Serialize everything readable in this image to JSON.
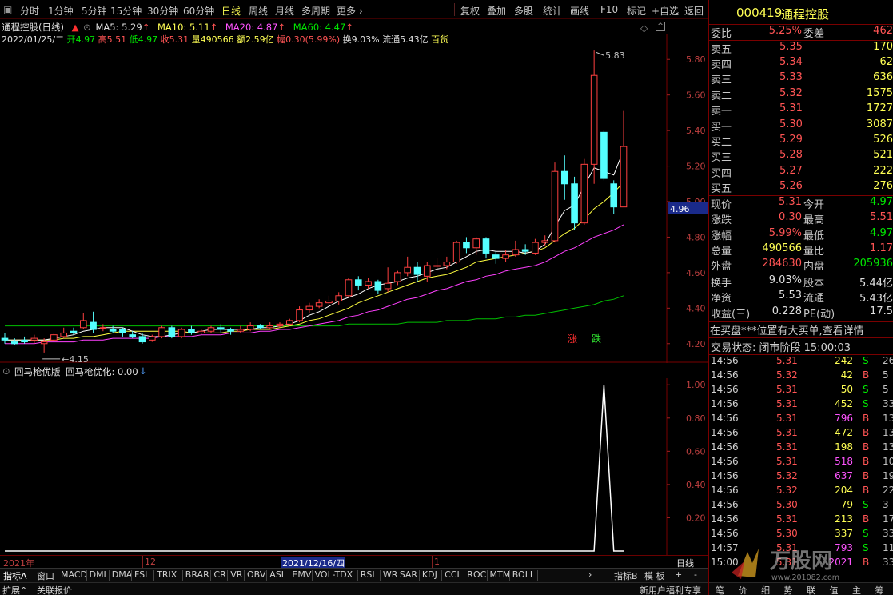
{
  "toolbar": {
    "left_items": [
      "分时",
      "1分钟",
      "5分钟",
      "15分钟",
      "30分钟",
      "60分钟",
      "日线",
      "周线",
      "月线",
      "多周期",
      "更多"
    ],
    "active_index": 6,
    "right_items": [
      "复权",
      "叠加",
      "多股",
      "统计",
      "画线",
      "F10",
      "标记",
      "+自选",
      "返回"
    ]
  },
  "info": {
    "title": "通程控股(日线)",
    "ma5": "MA5: 5.29",
    "ma10": "MA10: 5.11",
    "ma20": "MA20: 4.87",
    "ma60": "MA60: 4.47",
    "date": "2022/01/25/二",
    "open": "开4.97",
    "high": "高5.51",
    "low": "低4.97",
    "close": "收5.31",
    "vol": "量490566",
    "amount": "额2.59亿",
    "change": "幅0.30(5.99%)",
    "turnover": "换9.03%",
    "float": "流通5.43亿",
    "sector": "百货"
  },
  "chart_data": {
    "type": "candlestick",
    "price_ticks": [
      "5.80",
      "5.60",
      "5.40",
      "5.20",
      "5.00",
      "4.80",
      "4.60",
      "4.40",
      "4.20"
    ],
    "current_price_label": "4.96",
    "max_label": "5.83",
    "min_label": "4.15",
    "candles": [
      [
        4.23,
        4.22,
        4.26,
        4.2
      ],
      [
        4.21,
        4.2,
        4.23,
        4.19
      ],
      [
        4.22,
        4.21,
        4.24,
        4.2
      ],
      [
        4.22,
        4.23,
        4.25,
        4.2
      ],
      [
        4.2,
        4.21,
        4.23,
        4.15
      ],
      [
        4.22,
        4.25,
        4.26,
        4.21
      ],
      [
        4.24,
        4.26,
        4.29,
        4.23
      ],
      [
        4.27,
        4.26,
        4.29,
        4.25
      ],
      [
        4.29,
        4.33,
        4.37,
        4.28
      ],
      [
        4.32,
        4.28,
        4.38,
        4.26
      ],
      [
        4.29,
        4.29,
        4.31,
        4.27
      ],
      [
        4.28,
        4.27,
        4.3,
        4.26
      ],
      [
        4.28,
        4.26,
        4.29,
        4.24
      ],
      [
        4.25,
        4.24,
        4.27,
        4.23
      ],
      [
        4.24,
        4.21,
        4.26,
        4.2
      ],
      [
        4.22,
        4.24,
        4.25,
        4.21
      ],
      [
        4.24,
        4.29,
        4.3,
        4.23
      ],
      [
        4.29,
        4.24,
        4.3,
        4.23
      ],
      [
        4.24,
        4.28,
        4.29,
        4.23
      ],
      [
        4.28,
        4.26,
        4.3,
        4.25
      ],
      [
        4.26,
        4.27,
        4.28,
        4.25
      ],
      [
        4.27,
        4.29,
        4.3,
        4.26
      ],
      [
        4.29,
        4.28,
        4.31,
        4.26
      ],
      [
        4.28,
        4.27,
        4.29,
        4.25
      ],
      [
        4.27,
        4.28,
        4.3,
        4.26
      ],
      [
        4.28,
        4.3,
        4.32,
        4.27
      ],
      [
        4.3,
        4.29,
        4.31,
        4.28
      ],
      [
        4.29,
        4.3,
        4.32,
        4.28
      ],
      [
        4.3,
        4.31,
        4.32,
        4.29
      ],
      [
        4.31,
        4.33,
        4.34,
        4.3
      ],
      [
        4.33,
        4.39,
        4.41,
        4.32
      ],
      [
        4.39,
        4.41,
        4.43,
        4.37
      ],
      [
        4.41,
        4.43,
        4.45,
        4.4
      ],
      [
        4.43,
        4.44,
        4.47,
        4.41
      ],
      [
        4.44,
        4.47,
        4.49,
        4.42
      ],
      [
        4.47,
        4.56,
        4.57,
        4.46
      ],
      [
        4.56,
        4.53,
        4.58,
        4.5
      ],
      [
        4.53,
        4.55,
        4.57,
        4.51
      ],
      [
        4.55,
        4.5,
        4.56,
        4.48
      ],
      [
        4.51,
        4.54,
        4.63,
        4.49
      ],
      [
        4.55,
        4.6,
        4.61,
        4.53
      ],
      [
        4.6,
        4.63,
        4.69,
        4.58
      ],
      [
        4.63,
        4.59,
        4.66,
        4.55
      ],
      [
        4.58,
        4.64,
        4.66,
        4.55
      ],
      [
        4.64,
        4.64,
        4.68,
        4.61
      ],
      [
        4.64,
        4.66,
        4.69,
        4.62
      ],
      [
        4.66,
        4.77,
        4.78,
        4.65
      ],
      [
        4.77,
        4.74,
        4.8,
        4.71
      ],
      [
        4.74,
        4.79,
        4.8,
        4.7
      ],
      [
        4.79,
        4.71,
        4.8,
        4.68
      ],
      [
        4.7,
        4.68,
        4.72,
        4.65
      ],
      [
        4.68,
        4.7,
        4.73,
        4.66
      ],
      [
        4.7,
        4.73,
        4.78,
        4.69
      ],
      [
        4.73,
        4.72,
        4.76,
        4.7
      ],
      [
        4.71,
        4.77,
        4.79,
        4.7
      ],
      [
        4.77,
        4.78,
        4.81,
        4.75
      ],
      [
        4.78,
        5.17,
        5.22,
        4.77
      ],
      [
        5.17,
        5.1,
        5.26,
        5.01
      ],
      [
        5.1,
        4.88,
        5.14,
        4.84
      ],
      [
        4.88,
        5.21,
        5.24,
        4.87
      ],
      [
        5.21,
        5.71,
        5.85,
        5.1
      ],
      [
        5.39,
        5.13,
        5.4,
        5.12
      ],
      [
        5.1,
        4.97,
        5.12,
        4.93
      ],
      [
        4.97,
        5.31,
        5.51,
        4.97
      ]
    ],
    "ma5": [
      4.22,
      4.22,
      4.22,
      4.22,
      4.22,
      4.23,
      4.24,
      4.25,
      4.27,
      4.28,
      4.29,
      4.29,
      4.29,
      4.27,
      4.25,
      4.24,
      4.24,
      4.25,
      4.26,
      4.26,
      4.27,
      4.28,
      4.28,
      4.28,
      4.28,
      4.28,
      4.29,
      4.29,
      4.3,
      4.31,
      4.33,
      4.36,
      4.38,
      4.41,
      4.44,
      4.46,
      4.48,
      4.51,
      4.53,
      4.54,
      4.55,
      4.57,
      4.58,
      4.6,
      4.62,
      4.63,
      4.66,
      4.69,
      4.72,
      4.73,
      4.72,
      4.72,
      4.72,
      4.71,
      4.72,
      4.76,
      4.86,
      4.95,
      4.98,
      5.09,
      5.19,
      5.17,
      5.15,
      5.29
    ],
    "ma10": [
      4.22,
      4.22,
      4.22,
      4.22,
      4.22,
      4.22,
      4.23,
      4.23,
      4.24,
      4.24,
      4.25,
      4.26,
      4.27,
      4.27,
      4.27,
      4.27,
      4.27,
      4.27,
      4.27,
      4.26,
      4.26,
      4.26,
      4.26,
      4.27,
      4.27,
      4.28,
      4.28,
      4.28,
      4.29,
      4.3,
      4.31,
      4.33,
      4.34,
      4.36,
      4.38,
      4.4,
      4.43,
      4.45,
      4.47,
      4.49,
      4.51,
      4.53,
      4.55,
      4.57,
      4.58,
      4.59,
      4.61,
      4.63,
      4.66,
      4.67,
      4.68,
      4.69,
      4.7,
      4.71,
      4.72,
      4.74,
      4.78,
      4.82,
      4.85,
      4.9,
      4.96,
      5.0,
      5.05,
      5.11
    ],
    "ma20": [
      4.2,
      4.2,
      4.2,
      4.2,
      4.21,
      4.21,
      4.21,
      4.21,
      4.22,
      4.22,
      4.22,
      4.23,
      4.23,
      4.23,
      4.23,
      4.23,
      4.24,
      4.24,
      4.24,
      4.24,
      4.25,
      4.25,
      4.25,
      4.26,
      4.26,
      4.26,
      4.27,
      4.27,
      4.28,
      4.28,
      4.29,
      4.3,
      4.31,
      4.32,
      4.33,
      4.35,
      4.36,
      4.38,
      4.39,
      4.41,
      4.43,
      4.45,
      4.46,
      4.48,
      4.5,
      4.51,
      4.53,
      4.55,
      4.56,
      4.58,
      4.59,
      4.61,
      4.62,
      4.63,
      4.64,
      4.66,
      4.69,
      4.72,
      4.74,
      4.77,
      4.8,
      4.82,
      4.84,
      4.87
    ],
    "ma60": [
      4.3,
      4.3,
      4.3,
      4.3,
      4.3,
      4.3,
      4.3,
      4.3,
      4.3,
      4.3,
      4.3,
      4.3,
      4.3,
      4.3,
      4.3,
      4.3,
      4.3,
      4.3,
      4.3,
      4.3,
      4.3,
      4.3,
      4.3,
      4.3,
      4.3,
      4.3,
      4.3,
      4.3,
      4.3,
      4.3,
      4.3,
      4.3,
      4.3,
      4.3,
      4.3,
      4.31,
      4.31,
      4.31,
      4.31,
      4.31,
      4.31,
      4.32,
      4.32,
      4.32,
      4.32,
      4.33,
      4.33,
      4.33,
      4.34,
      4.34,
      4.34,
      4.35,
      4.35,
      4.36,
      4.36,
      4.37,
      4.38,
      4.39,
      4.4,
      4.41,
      4.42,
      4.44,
      4.45,
      4.47
    ],
    "sub_ticks": [
      "1.00",
      "0.80",
      "0.60",
      "0.40",
      "0.20"
    ],
    "signal": [
      0,
      0,
      0,
      0,
      0,
      0,
      0,
      0,
      0,
      0,
      0,
      0,
      0,
      0,
      0,
      0,
      0,
      0,
      0,
      0,
      0,
      0,
      0,
      0,
      0,
      0,
      0,
      0,
      0,
      0,
      0,
      0,
      0,
      0,
      0,
      0,
      0,
      0,
      0,
      0,
      0,
      0,
      0,
      0,
      0,
      0,
      0,
      0,
      0,
      0,
      0,
      0,
      0,
      0,
      0,
      0,
      0,
      0,
      0,
      0,
      0,
      1,
      0,
      0
    ]
  },
  "markers": {
    "up": "涨",
    "down": "跌"
  },
  "sub": {
    "name": "回马枪优版",
    "value": "回马枪优化: 0.00"
  },
  "dateaxis": {
    "year": "2021年",
    "month12": "12",
    "selected_date": "2021/12/16/四",
    "month1": "1",
    "period": "日线"
  },
  "indicator_tabs": [
    "指标A",
    "窗口",
    "MACD",
    "DMI",
    "DMA",
    "FSL",
    "TRIX",
    "BRAR",
    "CR",
    "VR",
    "OBV",
    "ASI",
    "EMV",
    "VOL-TDX",
    "RSI",
    "WR",
    "SAR",
    "KDJ",
    "CCI",
    "ROC",
    "MTM",
    "BOLL"
  ],
  "indicator_right": [
    "指标B",
    "模 板",
    "+",
    "-"
  ],
  "status": {
    "left1": "扩展^",
    "left2": "关联报价",
    "promo": "新用户福利专享",
    "right_items": [
      "笔",
      "价",
      "细",
      "势",
      "联",
      "值",
      "主",
      "筹"
    ]
  },
  "quote": {
    "code": "000419",
    "name": "通程控股",
    "weibi_label": "委比",
    "weibi": "5.25%",
    "weicha_label": "委差",
    "weicha": "462",
    "asks": [
      {
        "label": "卖五",
        "price": "5.35",
        "vol": "170"
      },
      {
        "label": "卖四",
        "price": "5.34",
        "vol": "62"
      },
      {
        "label": "卖三",
        "price": "5.33",
        "vol": "636"
      },
      {
        "label": "卖二",
        "price": "5.32",
        "vol": "1575"
      },
      {
        "label": "卖一",
        "price": "5.31",
        "vol": "1727"
      }
    ],
    "bids": [
      {
        "label": "买一",
        "price": "5.30",
        "vol": "3087"
      },
      {
        "label": "买二",
        "price": "5.29",
        "vol": "526"
      },
      {
        "label": "买三",
        "price": "5.28",
        "vol": "521"
      },
      {
        "label": "买四",
        "price": "5.27",
        "vol": "222"
      },
      {
        "label": "买五",
        "price": "5.26",
        "vol": "276"
      }
    ],
    "stats": [
      {
        "l1": "现价",
        "v1": "5.31",
        "l2": "今开",
        "v2": "4.97",
        "c1": "red",
        "c2": "green"
      },
      {
        "l1": "涨跌",
        "v1": "0.30",
        "l2": "最高",
        "v2": "5.51",
        "c1": "red",
        "c2": "red"
      },
      {
        "l1": "涨幅",
        "v1": "5.99%",
        "l2": "最低",
        "v2": "4.97",
        "c1": "red",
        "c2": "green"
      },
      {
        "l1": "总量",
        "v1": "490566",
        "l2": "量比",
        "v2": "1.17",
        "c1": "yellow",
        "c2": "red"
      },
      {
        "l1": "外盘",
        "v1": "284630",
        "l2": "内盘",
        "v2": "205936",
        "c1": "red",
        "c2": "green"
      }
    ],
    "stats2": [
      {
        "l1": "换手",
        "v1": "9.03%",
        "l2": "股本",
        "v2": "5.44亿",
        "c1": "white",
        "c2": "white"
      },
      {
        "l1": "净资",
        "v1": "5.53",
        "l2": "流通",
        "v2": "5.43亿",
        "c1": "white",
        "c2": "white"
      },
      {
        "l1": "收益(三)",
        "v1": "0.228",
        "l2": "PE(动)",
        "v2": "17.5",
        "c1": "white",
        "c2": "white"
      }
    ],
    "notice": "在买盘***位置有大买单,查看详情",
    "trade_state": "交易状态: 闭市阶段 15:00:03",
    "ticks": [
      {
        "t": "14:56",
        "p": "5.31",
        "v": "242",
        "d": "S",
        "n": "26",
        "pc": "red",
        "vc": "yellow"
      },
      {
        "t": "14:56",
        "p": "5.32",
        "v": "42",
        "d": "B",
        "n": "5",
        "pc": "red",
        "vc": "yellow"
      },
      {
        "t": "14:56",
        "p": "5.31",
        "v": "50",
        "d": "S",
        "n": "5",
        "pc": "red",
        "vc": "yellow"
      },
      {
        "t": "14:56",
        "p": "5.31",
        "v": "452",
        "d": "S",
        "n": "33",
        "pc": "red",
        "vc": "yellow"
      },
      {
        "t": "14:56",
        "p": "5.31",
        "v": "796",
        "d": "B",
        "n": "13",
        "pc": "red",
        "vc": "magenta"
      },
      {
        "t": "14:56",
        "p": "5.31",
        "v": "472",
        "d": "B",
        "n": "13",
        "pc": "red",
        "vc": "yellow"
      },
      {
        "t": "14:56",
        "p": "5.31",
        "v": "198",
        "d": "B",
        "n": "13",
        "pc": "red",
        "vc": "yellow"
      },
      {
        "t": "14:56",
        "p": "5.31",
        "v": "518",
        "d": "B",
        "n": "10",
        "pc": "red",
        "vc": "magenta"
      },
      {
        "t": "14:56",
        "p": "5.32",
        "v": "637",
        "d": "B",
        "n": "19",
        "pc": "red",
        "vc": "magenta"
      },
      {
        "t": "14:56",
        "p": "5.32",
        "v": "204",
        "d": "B",
        "n": "22",
        "pc": "red",
        "vc": "yellow"
      },
      {
        "t": "14:56",
        "p": "5.30",
        "v": "79",
        "d": "S",
        "n": "3",
        "pc": "red",
        "vc": "yellow"
      },
      {
        "t": "14:56",
        "p": "5.31",
        "v": "213",
        "d": "B",
        "n": "17",
        "pc": "red",
        "vc": "yellow"
      },
      {
        "t": "14:56",
        "p": "5.30",
        "v": "337",
        "d": "S",
        "n": "33",
        "pc": "red",
        "vc": "yellow"
      },
      {
        "t": "14:57",
        "p": "5.31",
        "v": "793",
        "d": "S",
        "n": "11",
        "pc": "red",
        "vc": "magenta"
      },
      {
        "t": "15:00",
        "p": "5.31",
        "v": "2021",
        "d": "B",
        "n": "336",
        "pc": "red",
        "vc": "magenta"
      }
    ]
  },
  "watermark": {
    "brand": "万股网",
    "url": "www.201082.com"
  }
}
